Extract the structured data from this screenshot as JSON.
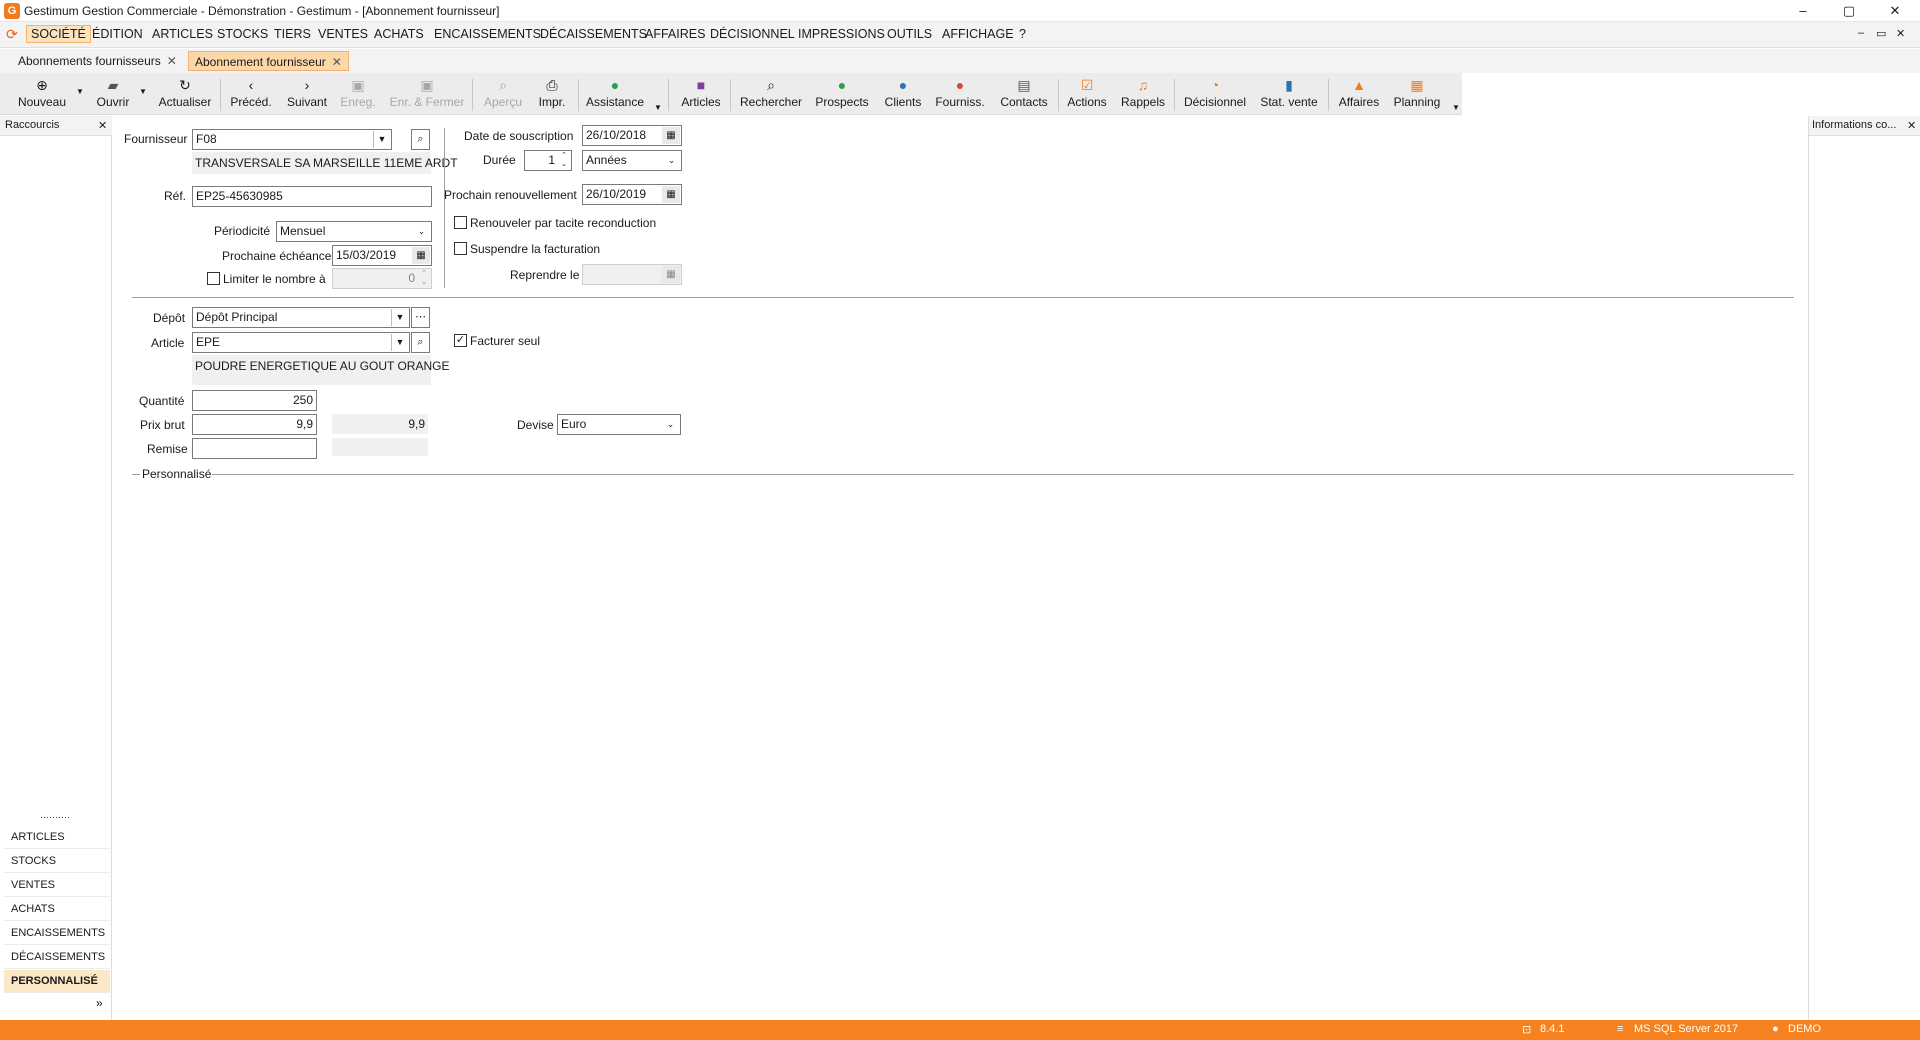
{
  "window": {
    "title": "Gestimum Gestion Commerciale - Démonstration - Gestimum - [Abonnement fournisseur]",
    "minimize": "–",
    "maximize": "▢",
    "close": "✕"
  },
  "menu": {
    "items": [
      "SOCIÉTÉ",
      "ÉDITION",
      "ARTICLES",
      "STOCKS",
      "TIERS",
      "VENTES",
      "ACHATS",
      "ENCAISSEMENTS",
      "DÉCAISSEMENTS",
      "AFFAIRES",
      "DÉCISIONNEL",
      "IMPRESSIONS",
      "OUTILS",
      "AFFICHAGE",
      "?"
    ],
    "active_index": 0,
    "mdi": [
      "–",
      "▭",
      "✕"
    ]
  },
  "doc_tabs": [
    {
      "label": "Abonnements fournisseurs",
      "close": "✕"
    },
    {
      "label": "Abonnement fournisseur",
      "close": "✕"
    }
  ],
  "toolbar": {
    "nouveau": "Nouveau",
    "ouvrir": "Ouvrir",
    "actualiser": "Actualiser",
    "preced": "Précéd.",
    "suivant": "Suivant",
    "enreg": "Enreg.",
    "enr_fermer": "Enr. & Fermer",
    "apercu": "Aperçu",
    "impr": "Impr.",
    "assistance": "Assistance",
    "articles": "Articles",
    "rechercher": "Rechercher",
    "prospects": "Prospects",
    "clients": "Clients",
    "fourniss": "Fourniss.",
    "contacts": "Contacts",
    "actions": "Actions",
    "rappels": "Rappels",
    "decisionnel": "Décisionnel",
    "stat_vente": "Stat. vente",
    "affaires": "Affaires",
    "planning": "Planning"
  },
  "left_panel": {
    "title": "Raccourcis",
    "close": "✕",
    "grip": "··········",
    "items": [
      "ARTICLES",
      "STOCKS",
      "VENTES",
      "ACHATS",
      "ENCAISSEMENTS",
      "DÉCAISSEMENTS",
      "PERSONNALISÉ"
    ],
    "active_index": 6,
    "more": "»"
  },
  "right_panel": {
    "title": "Informations co...",
    "close": "✕"
  },
  "form": {
    "fournisseur_label": "Fournisseur",
    "fournisseur_value": "F08",
    "fournisseur_name": "TRANSVERSALE SA MARSEILLE 11EME ARDT",
    "ref_label": "Réf.",
    "ref_value": "EP25-45630985",
    "periodicite_label": "Périodicité",
    "periodicite_value": "Mensuel",
    "prochaine_echeance_label": "Prochaine échéance",
    "prochaine_echeance_value": "15/03/2019",
    "limiter_label": "Limiter le nombre à",
    "limiter_value": "0",
    "date_souscription_label": "Date de souscription",
    "date_souscription_value": "26/10/2018",
    "duree_label": "Durée",
    "duree_value": "1",
    "duree_unit": "Années",
    "prochain_renouvellement_label": "Prochain renouvellement",
    "prochain_renouvellement_value": "26/10/2019",
    "renouveler_label": "Renouveler par tacite reconduction",
    "suspendre_label": "Suspendre la facturation",
    "reprendre_label": "Reprendre le",
    "depot_label": "Dépôt",
    "depot_value": "Dépôt Principal",
    "article_label": "Article",
    "article_value": "EPE",
    "article_desc": "POUDRE ENERGETIQUE AU GOUT ORANGE",
    "facturer_seul_label": "Facturer seul",
    "facturer_seul_checked": true,
    "quantite_label": "Quantité",
    "quantite_value": "250",
    "prix_brut_label": "Prix brut",
    "prix_brut_value": "9,9",
    "prix_net_value": "9,9",
    "remise_label": "Remise",
    "devise_label": "Devise",
    "devise_value": "Euro",
    "personnalise_label": "Personnalisé"
  },
  "status": {
    "version": "8.4.1",
    "server": "MS SQL Server 2017",
    "user": "DEMO"
  },
  "colors": {
    "accent": "#f5821f",
    "active_tab": "#fcd8a8",
    "toolbar": "#ececec"
  }
}
